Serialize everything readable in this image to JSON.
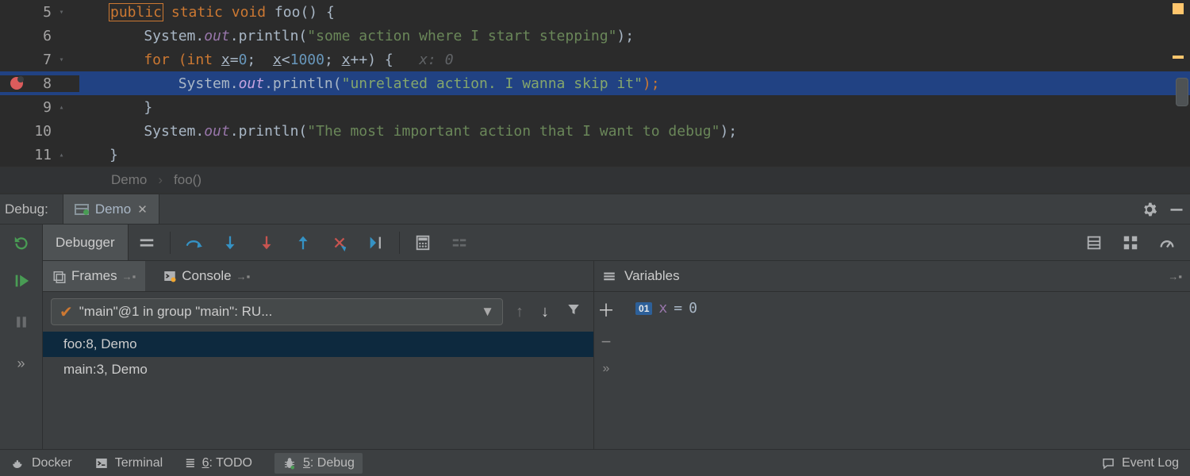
{
  "editor": {
    "lines": [
      {
        "num": "5"
      },
      {
        "num": "6"
      },
      {
        "num": "7"
      },
      {
        "num": "8"
      },
      {
        "num": "9"
      },
      {
        "num": "10"
      },
      {
        "num": "11"
      }
    ],
    "code": {
      "l5_public": "public",
      "l5_static_void": " static void",
      "l5_foo": " foo",
      "l5_rest": "() {",
      "l6_sys": "    System.",
      "l6_out": "out",
      "l6_println": ".println(",
      "l6_str": "\"some action where I start stepping\"",
      "l6_end": ");",
      "l7_for": "    for ",
      "l7_int": "(int ",
      "l7_x": "x",
      "l7_eq": "=",
      "l7_zero": "0",
      "l7_sc1": ";  ",
      "l7_x2": "x",
      "l7_lt": "<",
      "l7_thou": "1000",
      "l7_sc2": "; ",
      "l7_x3": "x",
      "l7_pp": "++) {",
      "l7_inlay": "   x: 0",
      "l8_sys": "        System.",
      "l8_out": "out",
      "l8_println": ".println(",
      "l8_str": "\"unrelated action. I wanna skip it\"",
      "l8_end": ");",
      "l9": "    }",
      "l10_sys": "    System.",
      "l10_out": "out",
      "l10_println": ".println(",
      "l10_str": "\"The most important action that I want to debug\"",
      "l10_end": ");",
      "l11": "}"
    }
  },
  "breadcrumbs": {
    "a": "Demo",
    "b": "foo()"
  },
  "debug": {
    "label": "Debug:",
    "run_config": "Demo",
    "debugger_tab": "Debugger",
    "frames_tab": "Frames",
    "console_tab": "Console",
    "variables_tab": "Variables",
    "thread": "\"main\"@1 in group \"main\": RU...",
    "frames": [
      "foo:8, Demo",
      "main:3, Demo"
    ],
    "var_badge": "01",
    "var_name": "x",
    "var_eq": " = ",
    "var_val": "0"
  },
  "status": {
    "docker": "Docker",
    "terminal": "Terminal",
    "todo_pre": "≣ ",
    "todo_num": "6",
    "todo_txt": ": TODO",
    "debug_num": "5",
    "debug_txt": ": Debug",
    "event_log": "Event Log"
  }
}
